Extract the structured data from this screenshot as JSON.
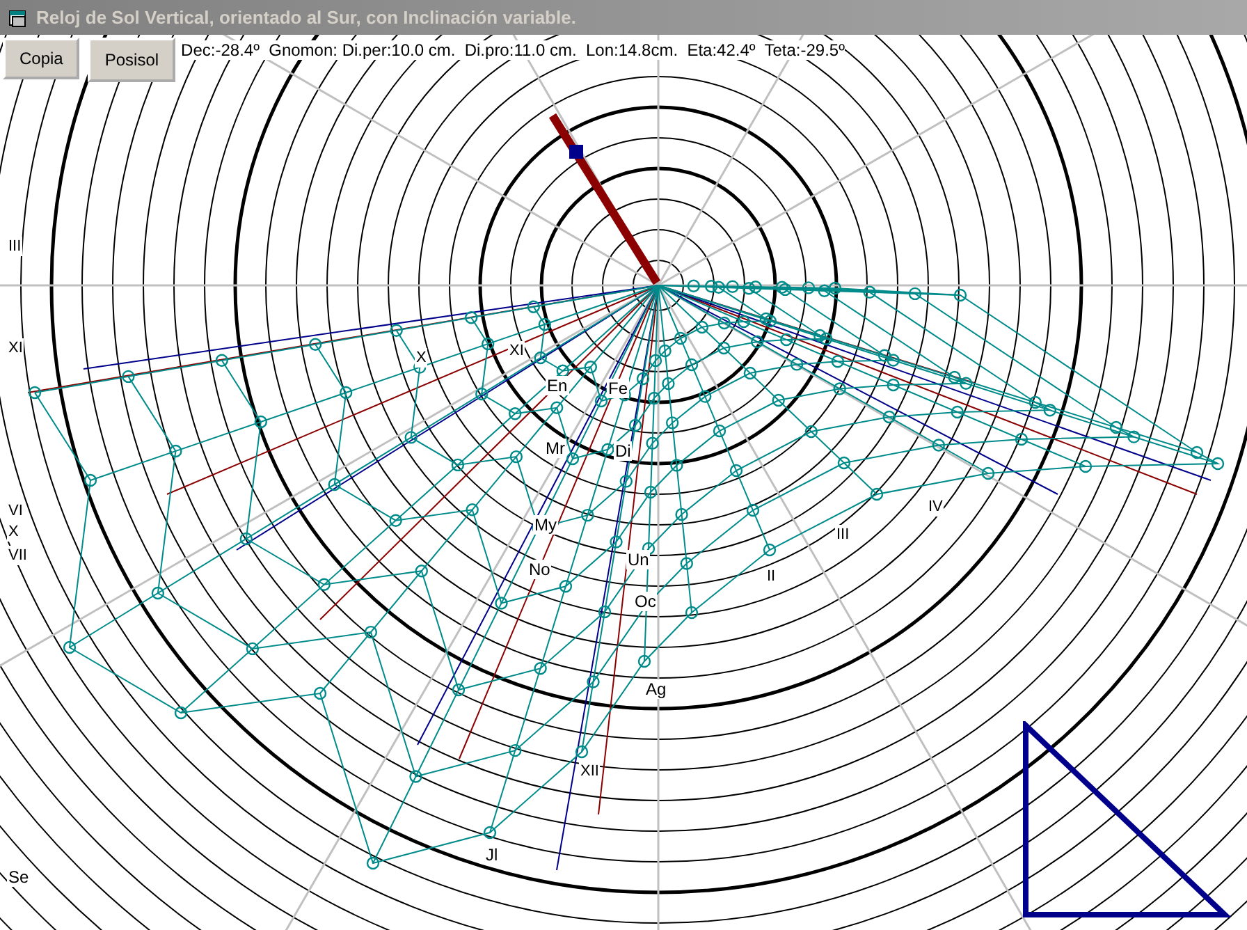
{
  "window": {
    "title": "Reloj de Sol Vertical, orientado al Sur, con Inclinación variable."
  },
  "buttons": [
    "Copia",
    "Posisol"
  ],
  "info": "Dec:-28.4º  Gnomon: Di.per:10.0 cm.  Di.pro:11.0 cm.  Lon:14.8cm.  Eta:42.4º  Teta:-29.5º",
  "labels": [
    {
      "text": "III",
      "kind": "hour"
    },
    {
      "text": "XI",
      "kind": "hour"
    },
    {
      "text": "VI",
      "kind": "hour"
    },
    {
      "text": "X",
      "kind": "hour"
    },
    {
      "text": "VII",
      "kind": "hour"
    },
    {
      "text": "X",
      "kind": "hour"
    },
    {
      "text": "XI",
      "kind": "hour"
    },
    {
      "text": "En",
      "kind": "month"
    },
    {
      "text": "Fe",
      "kind": "month"
    },
    {
      "text": "Mr",
      "kind": "month"
    },
    {
      "text": "Di",
      "kind": "month"
    },
    {
      "text": "My",
      "kind": "month"
    },
    {
      "text": "Un",
      "kind": "month"
    },
    {
      "text": "No",
      "kind": "month"
    },
    {
      "text": "Oc",
      "kind": "month"
    },
    {
      "text": "Ag",
      "kind": "month"
    },
    {
      "text": "XII",
      "kind": "hour"
    },
    {
      "text": "II",
      "kind": "hour"
    },
    {
      "text": "III",
      "kind": "hour"
    },
    {
      "text": "IV",
      "kind": "hour"
    },
    {
      "text": "Jl",
      "kind": "month"
    },
    {
      "text": "Se",
      "kind": "month"
    }
  ]
}
